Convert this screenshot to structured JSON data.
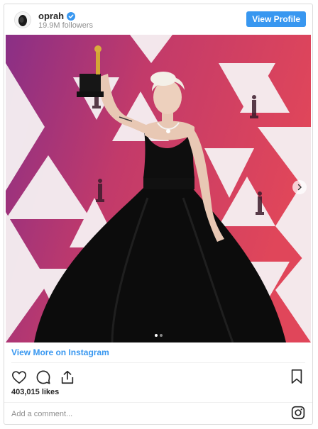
{
  "header": {
    "username": "oprah",
    "followers": "19.9M followers",
    "view_profile_label": "View Profile"
  },
  "media": {
    "carousel_total": 2,
    "carousel_active": 1,
    "icons": [
      "chevron-right-icon"
    ]
  },
  "footer": {
    "view_more_label": "View More on Instagram",
    "likes": "403,015 likes",
    "comment_placeholder": "Add a comment...",
    "action_icons": [
      "heart-icon",
      "comment-icon",
      "share-icon",
      "bookmark-icon",
      "instagram-icon"
    ]
  },
  "colors": {
    "accent": "#3897f0",
    "border": "#dbdbdb",
    "muted_text": "#8e8e8e",
    "backdrop_pink": "#d9455f",
    "backdrop_purple": "#7a2f7c"
  }
}
